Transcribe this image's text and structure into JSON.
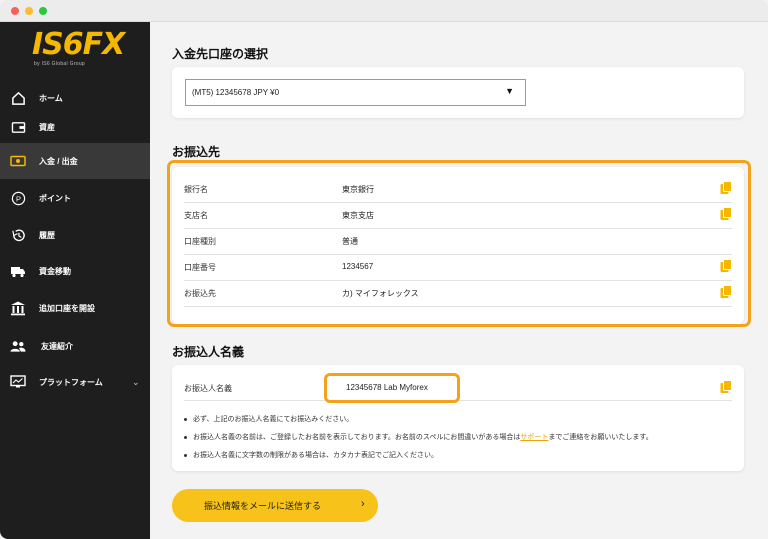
{
  "brand": {
    "logo": "IS6FX",
    "tagline": "by IS6 Global Group"
  },
  "nav": {
    "home": "ホーム",
    "assets": "資産",
    "deposit_withdraw": "入金 / 出金",
    "points": "ポイント",
    "history": "履歴",
    "transfer": "資金移動",
    "open_account": "追加口座を開設",
    "referral": "友達紹介",
    "platform": "プラットフォーム"
  },
  "account_select": {
    "title": "入金先口座の選択",
    "selected": "(MT5) 12345678 JPY ¥0"
  },
  "transfer_dest": {
    "title": "お振込先",
    "rows": [
      {
        "label": "銀行名",
        "value": "東京銀行"
      },
      {
        "label": "支店名",
        "value": "東京支店"
      },
      {
        "label": "口座種別",
        "value": "普通"
      },
      {
        "label": "口座番号",
        "value": "1234567"
      },
      {
        "label": "お振込先",
        "value": "カ) マイフォレックス"
      }
    ]
  },
  "remitter": {
    "title": "お振込人名義",
    "label": "お振込人名義",
    "value": "12345678 Lab Myforex",
    "notes": {
      "n1": "必ず、上記のお振込人名義にてお振込みください。",
      "n2_pre": "お振込人名義の名前は、ご登録したお名前を表示しております。お名前のスペルにお間違いがある場合は",
      "n2_link": "サポート",
      "n2_post": "までご連絡をお願いいたします。",
      "n3": "お振込人名義に文字数の制限がある場合は、カタカナ表記でご記入ください。"
    }
  },
  "send_button": {
    "label": "振込情報をメールに送信する",
    "arrow": "›"
  },
  "colors": {
    "accent": "#f5b800",
    "highlight": "#f4a21c",
    "sidebar": "#1e1e1e",
    "button": "#f7c21a"
  },
  "icons": [
    "home-icon",
    "wallet-icon",
    "cash-icon",
    "points-icon",
    "history-icon",
    "truck-icon",
    "bank-icon",
    "users-icon",
    "monitor-icon",
    "copy-icon",
    "chevron-down-icon",
    "arrow-right-icon"
  ]
}
